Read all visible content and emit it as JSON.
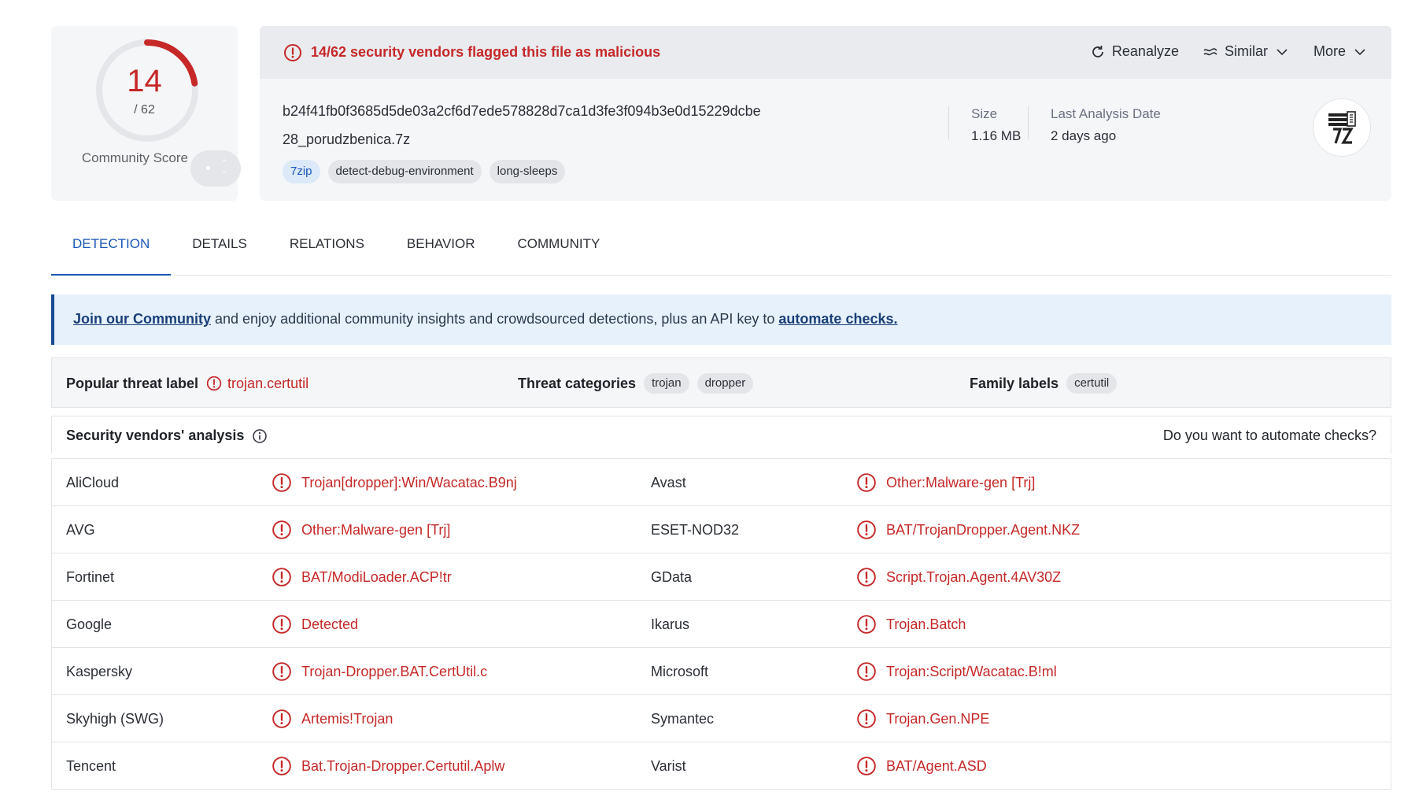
{
  "score": {
    "detections": "14",
    "total": "/ 62",
    "ratio": 0.2258,
    "community_label": "Community Score"
  },
  "alert": {
    "text": "14/62 security vendors flagged this file as malicious",
    "color": "#c62828"
  },
  "actions": {
    "reanalyze": "Reanalyze",
    "similar": "Similar",
    "more": "More"
  },
  "file": {
    "hash": "b24f41fb0f3685d5de03a2cf6d7ede578828d7ca1d3fe3f094b3e0d15229dcbe",
    "name": "28_porudzbenica.7z",
    "tags": [
      "7zip",
      "detect-debug-environment",
      "long-sleeps"
    ],
    "size_label": "Size",
    "size_value": "1.16 MB",
    "date_label": "Last Analysis Date",
    "date_value": "2 days ago",
    "type_icon": "7z-file-icon"
  },
  "tabs": [
    "DETECTION",
    "DETAILS",
    "RELATIONS",
    "BEHAVIOR",
    "COMMUNITY"
  ],
  "banner": {
    "link1": "Join our Community",
    "middle": " and enjoy additional community insights and crowdsourced detections, plus an API key to ",
    "link2": "automate checks."
  },
  "threat": {
    "popular_label": "Popular threat label",
    "popular_value": "trojan.certutil",
    "categories_label": "Threat categories",
    "categories": [
      "trojan",
      "dropper"
    ],
    "family_label": "Family labels",
    "families": [
      "certutil"
    ]
  },
  "vendors_header": {
    "title": "Security vendors' analysis",
    "right": "Do you want to automate checks?"
  },
  "vendors": [
    [
      "AliCloud",
      "Trojan[dropper]:Win/Wacatac.B9nj",
      "Avast",
      "Other:Malware-gen [Trj]"
    ],
    [
      "AVG",
      "Other:Malware-gen [Trj]",
      "ESET-NOD32",
      "BAT/TrojanDropper.Agent.NKZ"
    ],
    [
      "Fortinet",
      "BAT/ModiLoader.ACP!tr",
      "GData",
      "Script.Trojan.Agent.4AV30Z"
    ],
    [
      "Google",
      "Detected",
      "Ikarus",
      "Trojan.Batch"
    ],
    [
      "Kaspersky",
      "Trojan-Dropper.BAT.CertUtil.c",
      "Microsoft",
      "Trojan:Script/Wacatac.B!ml"
    ],
    [
      "Skyhigh (SWG)",
      "Artemis!Trojan",
      "Symantec",
      "Trojan.Gen.NPE"
    ],
    [
      "Tencent",
      "Bat.Trojan-Dropper.Certutil.Aplw",
      "Varist",
      "BAT/Agent.ASD"
    ]
  ],
  "colors": {
    "malicious": "#c62828",
    "accent": "#1a57b8"
  }
}
